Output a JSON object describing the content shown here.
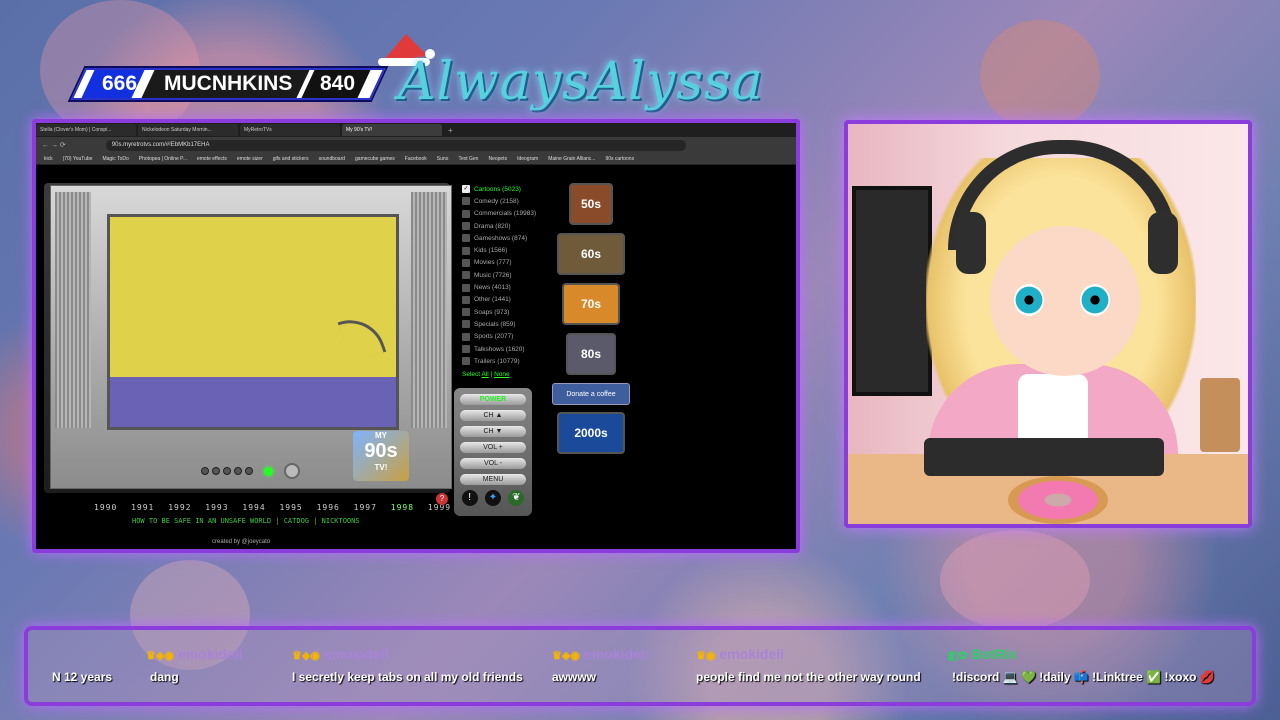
{
  "overlay": {
    "score_left": "666",
    "channel_label": "MUCNHKINS",
    "score_right": "840",
    "brand_text": "AlwaysAlyssa"
  },
  "browser": {
    "tabs": [
      {
        "label": "Stella (Clover's Mom) | Conspi...",
        "active": false
      },
      {
        "label": "Nickelodeon Saturday Mornin...",
        "active": false
      },
      {
        "label": "MyRetroTVs",
        "active": false
      },
      {
        "label": "My 90's TV!",
        "active": true
      }
    ],
    "url": "90s.myretrotvs.com/#!EbMKb17EHA",
    "bookmarks": [
      "kick",
      "(70) YouTube",
      "Magic ToDo",
      "Photopea | Online P...",
      "emote effects",
      "emote sizer",
      "gifs and stickers",
      "soundboard",
      "gamecube games",
      "Facebook",
      "Suno",
      "Text Gen",
      "Neopets",
      "Ideogram",
      "Maine Grain Allianc...",
      "90s cartoons"
    ]
  },
  "tv": {
    "years": [
      "1990",
      "1991",
      "1992",
      "1993",
      "1994",
      "1995",
      "1996",
      "1997",
      "1998",
      "1999"
    ],
    "current_year": "1998",
    "now_playing": "HOW TO BE SAFE IN AN UNSAFE WORLD | CATDOG | NICKTOONS",
    "logo_top": "MY",
    "logo_mid": "90s",
    "logo_bottom": "TV!",
    "credit": "created by @joeycato",
    "help_glyph": "?"
  },
  "categories": [
    {
      "label": "Cartoons (5023)",
      "checked": true
    },
    {
      "label": "Comedy (2158)",
      "checked": false
    },
    {
      "label": "Commercials (19983)",
      "checked": false
    },
    {
      "label": "Drama (820)",
      "checked": false
    },
    {
      "label": "Gameshows (874)",
      "checked": false
    },
    {
      "label": "Kids (1566)",
      "checked": false
    },
    {
      "label": "Movies (777)",
      "checked": false
    },
    {
      "label": "Music (7726)",
      "checked": false
    },
    {
      "label": "News (4013)",
      "checked": false
    },
    {
      "label": "Other (1441)",
      "checked": false
    },
    {
      "label": "Soaps (973)",
      "checked": false
    },
    {
      "label": "Specials (859)",
      "checked": false
    },
    {
      "label": "Sports (2077)",
      "checked": false
    },
    {
      "label": "Talkshows (1620)",
      "checked": false
    },
    {
      "label": "Trailers (10779)",
      "checked": false
    }
  ],
  "select": {
    "prefix": "Select",
    "all": "All",
    "sep": "|",
    "none": "None"
  },
  "remote": {
    "power": "POWER",
    "ch_up": "CH ▲",
    "ch_down": "CH ▼",
    "vol_up": "VOL +",
    "vol_down": "VOL -",
    "menu": "MENU"
  },
  "decades": [
    {
      "label": "50s",
      "color": "#8a4b2a"
    },
    {
      "label": "60s",
      "color": "#6f5a3a"
    },
    {
      "label": "70s",
      "color": "#d88a2a"
    },
    {
      "label": "80s",
      "color": "#5a5a6a"
    }
  ],
  "donate": "Donate a coffee",
  "decade_2000": "2000s",
  "chat": [
    {
      "user": "",
      "text": "N 12 years"
    },
    {
      "user": "emokideli",
      "text": "dang"
    },
    {
      "user": "emokideli",
      "text": "I secretly keep tabs on all my old friends"
    },
    {
      "user": "emokideli",
      "text": "awwww"
    },
    {
      "user": "emokideli",
      "text": "people find me not the other way round"
    },
    {
      "user": "BotRix",
      "text": "!discord 💻 💚 !daily 📫 !Linktree ✅ !xoxo 💋"
    }
  ],
  "colors": {
    "accent": "#8b3ddb",
    "led_green": "#22ff22",
    "chat_name": "#a883d8",
    "bot_name": "#2ccf63"
  }
}
